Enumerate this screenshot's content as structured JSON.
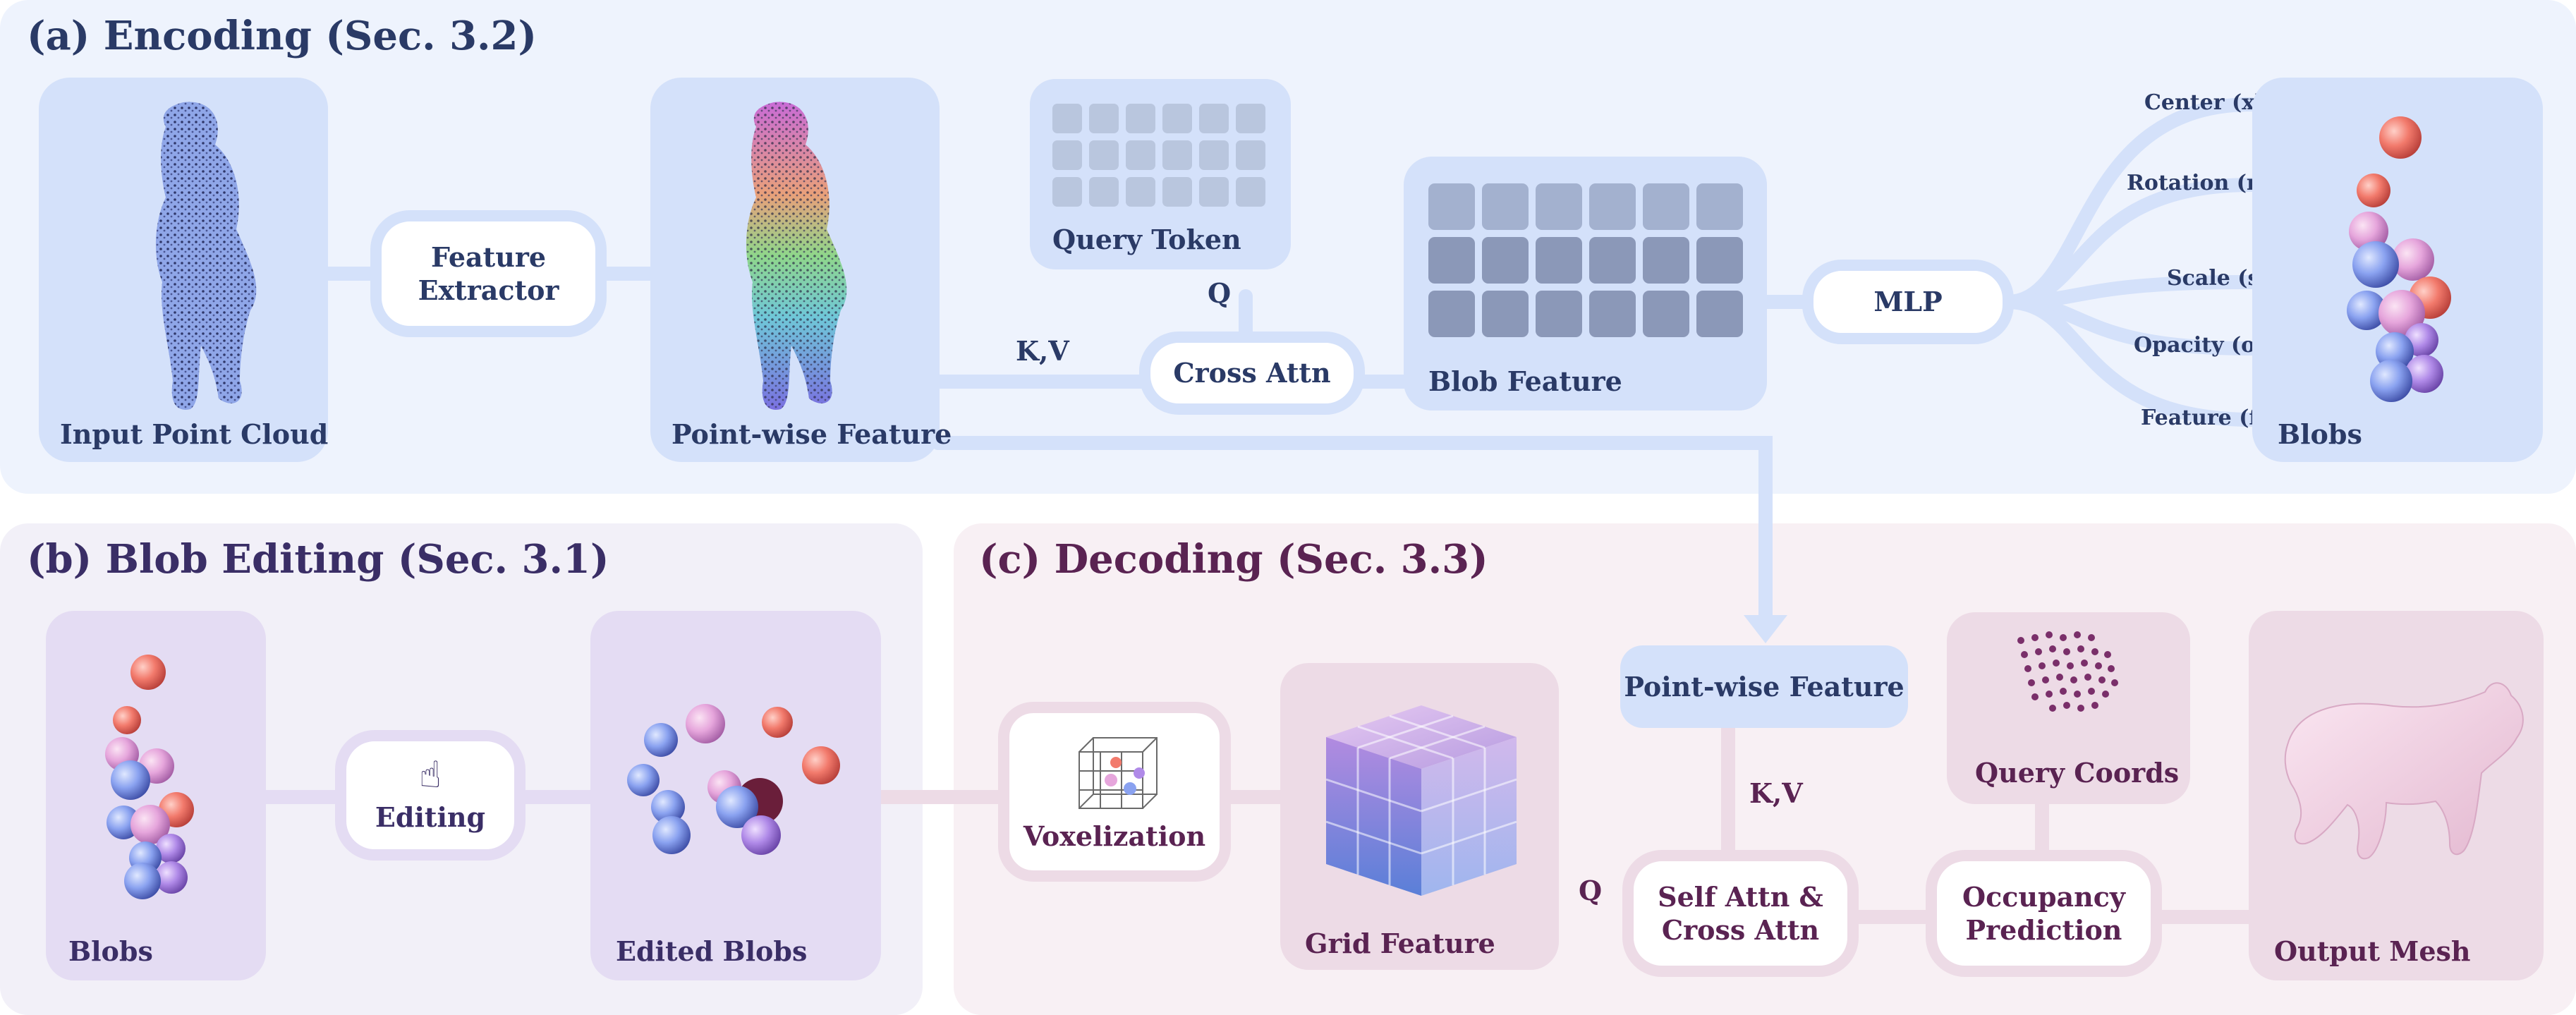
{
  "panels": {
    "encoding": {
      "title": "(a) Encoding (Sec. 3.2)",
      "input_point_cloud": "Input Point Cloud",
      "feature_extractor": "Feature\nExtractor",
      "pointwise_feature": "Point-wise Feature",
      "query_token": "Query Token",
      "q_label": "Q",
      "kv_label": "K,V",
      "cross_attn": "Cross Attn",
      "blob_feature": "Blob Feature",
      "mlp": "MLP",
      "outputs": [
        "Center (x)",
        "Rotation (r)",
        "Scale (s)",
        "Opacity (o)",
        "Feature (f)"
      ],
      "blobs": "Blobs"
    },
    "editing": {
      "title": "(b) Blob Editing (Sec. 3.1)",
      "blobs": "Blobs",
      "editing": "Editing",
      "edited_blobs": "Edited Blobs"
    },
    "decoding": {
      "title": "(c) Decoding (Sec. 3.3)",
      "voxelization": "Voxelization",
      "grid_feature": "Grid Feature",
      "pointwise_feature": "Point-wise Feature",
      "kv_label": "K,V",
      "q_label": "Q",
      "self_cross_attn": "Self Attn &\nCross Attn",
      "query_coords": "Query Coords",
      "occupancy_prediction": "Occupancy\nPrediction",
      "output_mesh": "Output Mesh"
    }
  },
  "colors": {
    "encoding_panel": "#eef3fd",
    "encoding_card": "#d4e1fa",
    "editing_panel": "#f2f0f8",
    "editing_card": "#e4dcf3",
    "decoding_panel": "#f8f0f4",
    "decoding_card": "#eddbe6",
    "token": "#b9c6de",
    "blob_token": "#8b98b8"
  }
}
